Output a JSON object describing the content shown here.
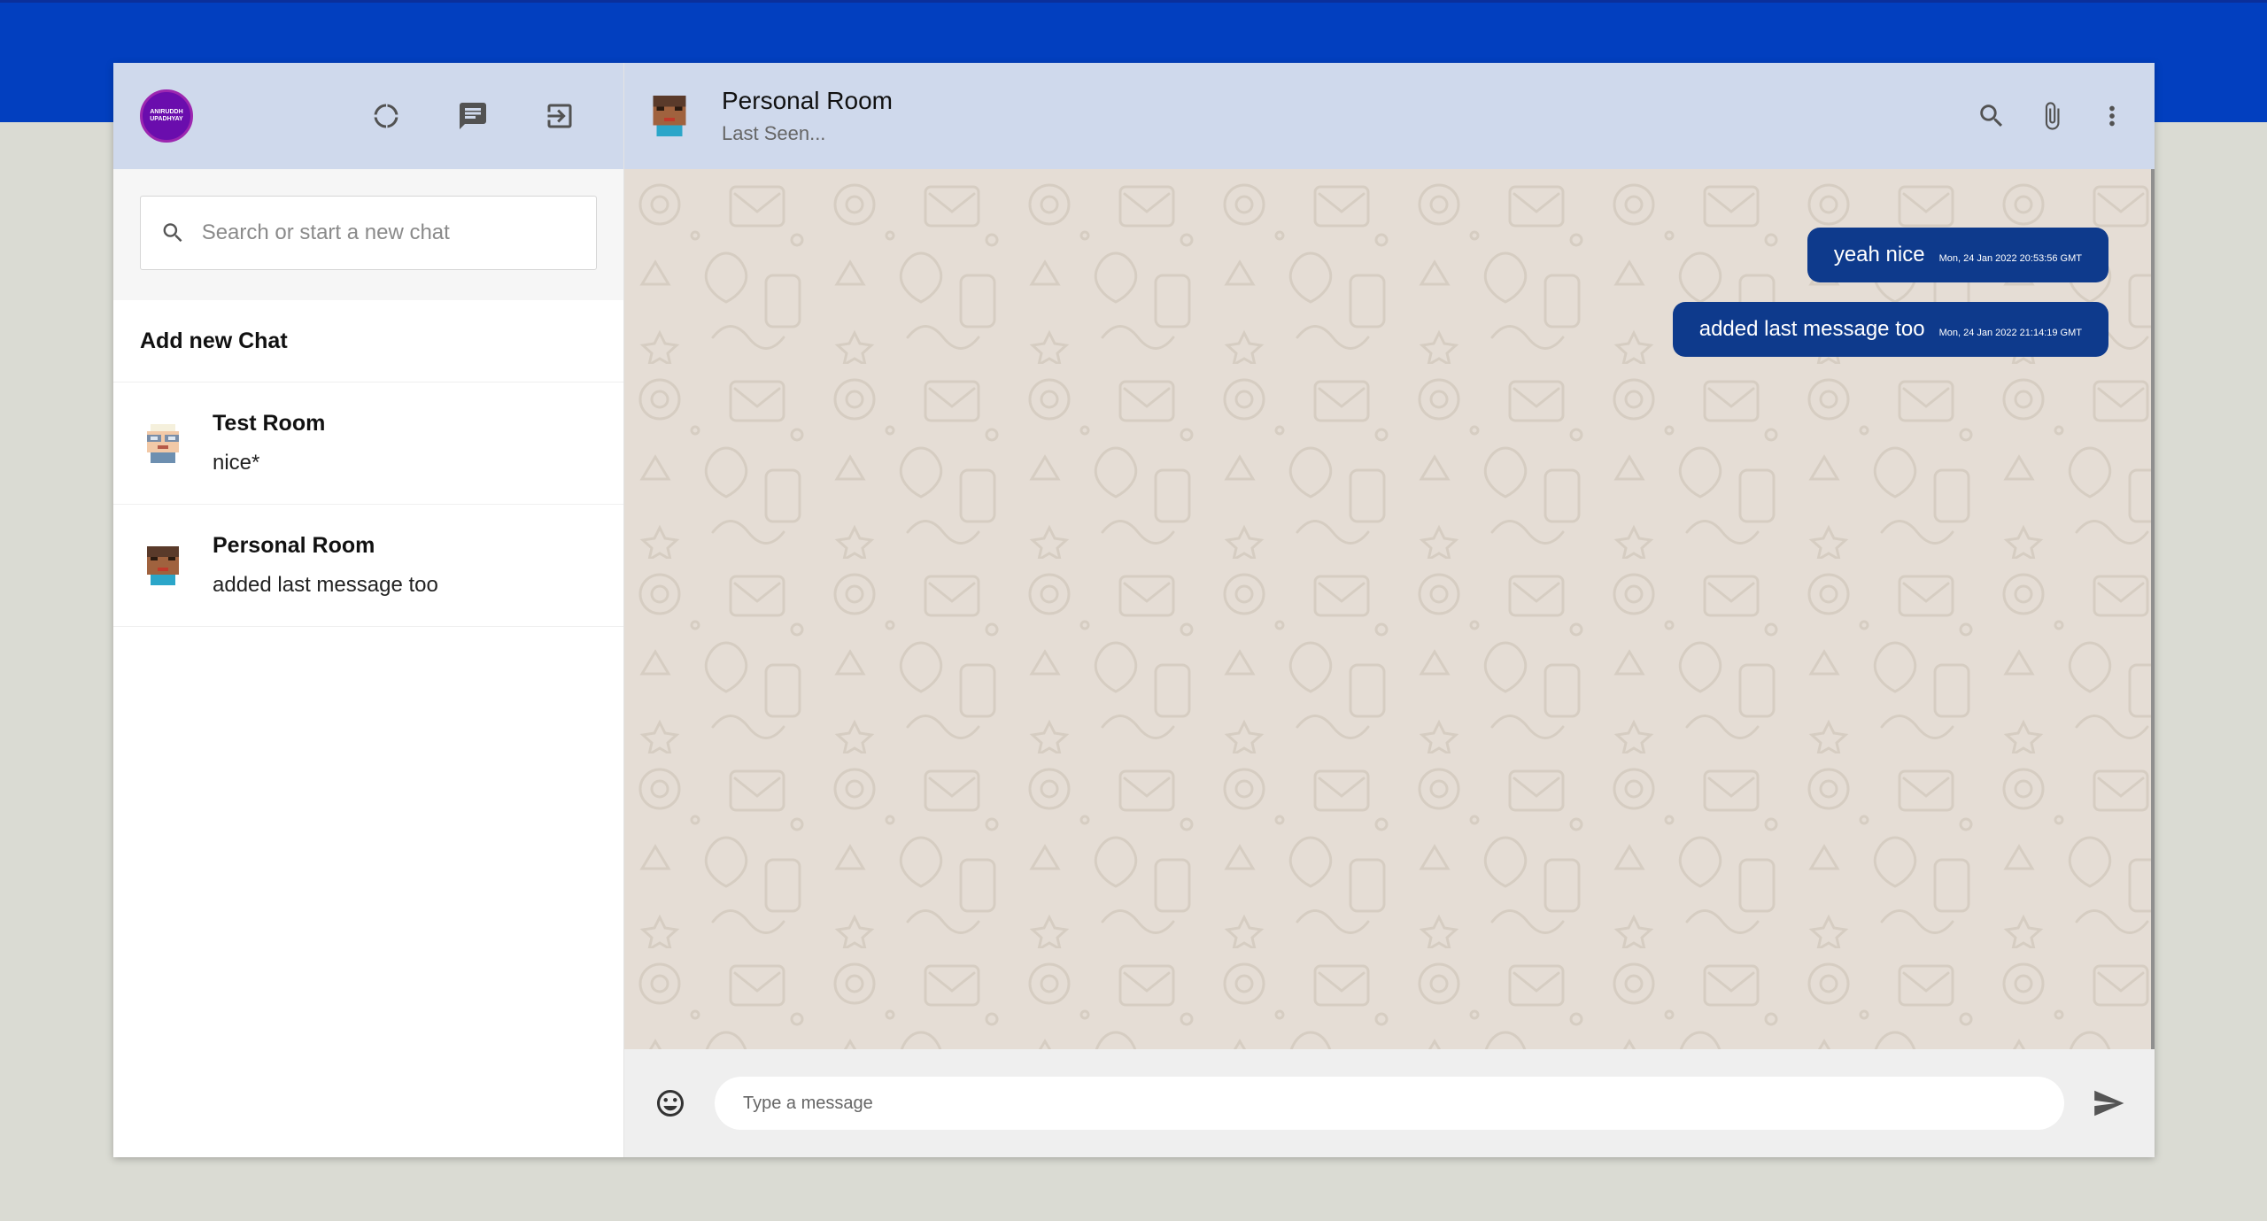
{
  "sidebar": {
    "logo_text": "ANIRUDDH UPADHYAY",
    "search_placeholder": "Search or start a new chat",
    "add_new_chat": "Add new Chat",
    "chats": [
      {
        "name": "Test Room",
        "last_message": "nice*"
      },
      {
        "name": "Personal Room",
        "last_message": "added last message too"
      }
    ]
  },
  "chat": {
    "room_name": "Personal Room",
    "last_seen": "Last Seen...",
    "messages": [
      {
        "text": "yeah nice",
        "timestamp": "Mon, 24 Jan 2022 20:53:56 GMT"
      },
      {
        "text": "added last message too",
        "timestamp": "Mon, 24 Jan 2022 21:14:19 GMT"
      }
    ],
    "input_placeholder": "Type a message"
  },
  "colors": {
    "brand_band": "#023fbf",
    "header_bg": "#cfd9ec",
    "bubble": "#0e3a8c",
    "chat_bg": "#e5ddd5"
  }
}
